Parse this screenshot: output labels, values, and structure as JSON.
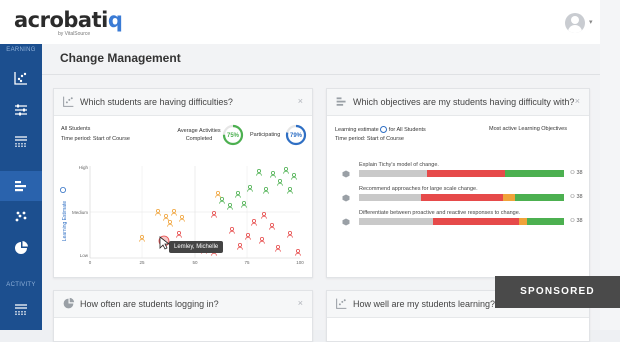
{
  "brand": {
    "name_main": "acrobati",
    "name_accent": "q",
    "sub": "by VitalSource"
  },
  "sidebar": {
    "section_learning": "EARNING",
    "section_activity": "ACTIVITY"
  },
  "page": {
    "title": "Change Management"
  },
  "card_difficulties": {
    "title": "Which students are having difficulties?",
    "close": "×",
    "students_label": "All Students",
    "time_period": "Time period: Start of Course",
    "avg_activities_label": "Average Activities Completed",
    "avg_activities_value": "75%",
    "participating_label": "Participating",
    "participating_value": "79%",
    "y_axis_label": "Learning Estimate",
    "y_ticks": [
      "High",
      "Medium",
      "Low"
    ],
    "x_ticks": [
      "0",
      "25",
      "50",
      "75",
      "100"
    ],
    "tooltip": "Lemley, Michelle"
  },
  "card_objectives": {
    "title": "Which objectives are my students having difficulty with?",
    "close": "×",
    "learning_estimate_prefix": "Learning estimate",
    "learning_estimate_for": "for All Students",
    "time_period": "Time period: Start of Course",
    "most_active_label": "Most active Learning Objectives",
    "objectives": [
      {
        "text": "Explain Tichy's model of change.",
        "count": "38",
        "segments": [
          {
            "c": "#c9c9c9",
            "w": 0.33
          },
          {
            "c": "#e64a4a",
            "w": 0.38
          },
          {
            "c": "#f0a33a",
            "w": 0.0
          },
          {
            "c": "#4cb050",
            "w": 0.29
          }
        ]
      },
      {
        "text": "Recommend approaches for large scale change.",
        "count": "38",
        "segments": [
          {
            "c": "#c9c9c9",
            "w": 0.3
          },
          {
            "c": "#e64a4a",
            "w": 0.4
          },
          {
            "c": "#f0a33a",
            "w": 0.06
          },
          {
            "c": "#4cb050",
            "w": 0.24
          }
        ]
      },
      {
        "text": "Differentiate between proactive and reactive responses to change.",
        "count": "38",
        "segments": [
          {
            "c": "#c9c9c9",
            "w": 0.36
          },
          {
            "c": "#e64a4a",
            "w": 0.42
          },
          {
            "c": "#f0a33a",
            "w": 0.04
          },
          {
            "c": "#4cb050",
            "w": 0.18
          }
        ]
      }
    ]
  },
  "card_logging": {
    "title": "How often are students logging in?",
    "close": "×"
  },
  "card_learning": {
    "title": "How well are my students learning?",
    "close": "×"
  },
  "sponsored": "SPONSORED",
  "colors": {
    "sidebar": "#1c4f8f",
    "accent": "#3a7bd5",
    "green": "#4cb050",
    "red": "#e64a4a",
    "orange": "#f0a33a",
    "gray": "#c9c9c9"
  }
}
